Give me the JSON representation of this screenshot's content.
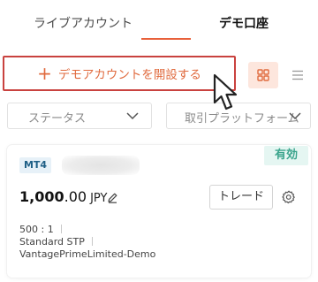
{
  "tabs": [
    {
      "label": "ライブアカウント",
      "active": false
    },
    {
      "label": "デモ口座",
      "active": true
    }
  ],
  "toolbar": {
    "open_demo_label": "デモアカウントを開設する",
    "plus_symbol": "+",
    "grid_view_icon": "grid-icon",
    "list_view_icon": "list-icon"
  },
  "filters": {
    "status_label": "ステータス",
    "platform_label": "取引プラットフォーム"
  },
  "account": {
    "platform_badge": "MT4",
    "status": "有効",
    "balance_int": "1,000",
    "balance_dec": ".00",
    "currency": "JPY",
    "trade_label": "トレード",
    "leverage": "500 : 1",
    "account_type": "Standard STP",
    "server": "VantagePrimeLimited-Demo"
  },
  "colors": {
    "accent": "#e8603a",
    "highlight_border": "#c9423f",
    "status_green": "#3aa48c",
    "badge_blue": "#1f5f86"
  }
}
